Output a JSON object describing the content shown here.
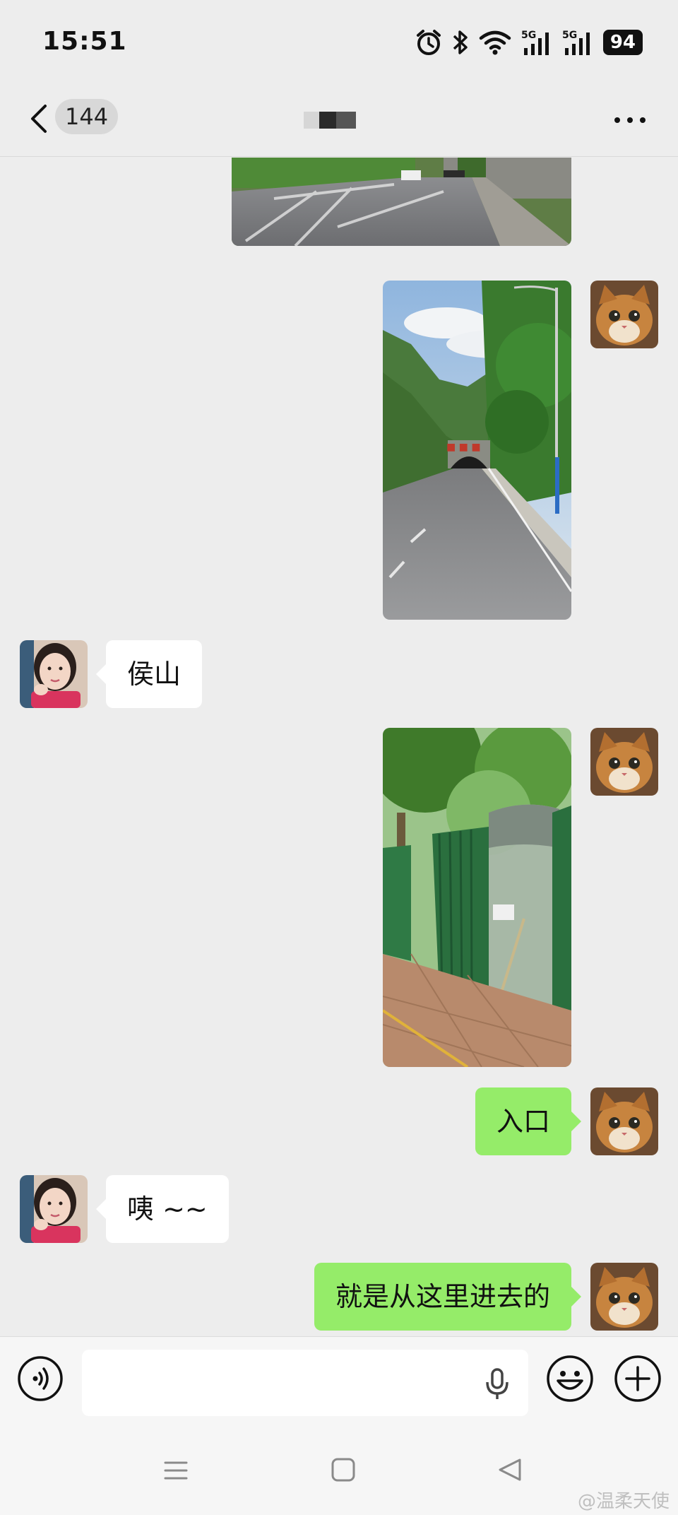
{
  "status_bar": {
    "time": "15:51",
    "network_1": "5G",
    "network_2": "5G",
    "battery": "94"
  },
  "header": {
    "unread_count": "144",
    "title_obscured": true
  },
  "messages": [
    {
      "side": "out",
      "type": "image",
      "depicts": "road-with-tunnel-landscape"
    },
    {
      "side": "out",
      "type": "image",
      "depicts": "road-leading-to-mountain-tunnel"
    },
    {
      "side": "in",
      "type": "text",
      "text": "侯山"
    },
    {
      "side": "out",
      "type": "image",
      "depicts": "green-construction-fence-entrance"
    },
    {
      "side": "out",
      "type": "text",
      "text": "入口"
    },
    {
      "side": "in",
      "type": "text",
      "text": "咦 ~~"
    },
    {
      "side": "out",
      "type": "text",
      "text": "就是从这里进去的"
    }
  ],
  "input": {
    "value": "",
    "placeholder": ""
  },
  "watermark": "@温柔天使",
  "colors": {
    "background": "#ededed",
    "outgoing_bubble": "#95ec69",
    "incoming_bubble": "#ffffff"
  }
}
